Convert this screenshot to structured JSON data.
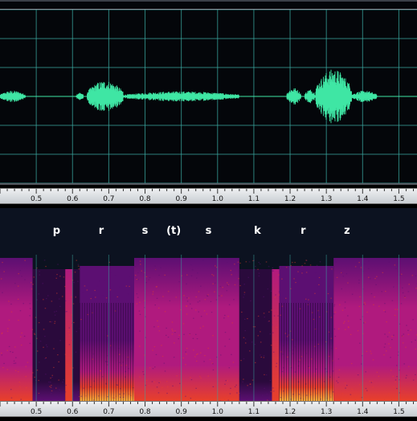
{
  "time_axis": {
    "unit": "s",
    "start": 0.4,
    "end": 1.55,
    "tick_labels": [
      "0.5",
      "0.6",
      "0.7",
      "0.8",
      "0.9",
      "1.0",
      "1.1",
      "1.2",
      "1.3",
      "1.4",
      "1.5"
    ]
  },
  "segments": [
    {
      "label": "p",
      "t": 0.556
    },
    {
      "label": "r",
      "t": 0.679
    },
    {
      "label": "s",
      "t": 0.8
    },
    {
      "label": "(t)",
      "t": 0.879
    },
    {
      "label": "s",
      "t": 0.975
    },
    {
      "label": "k",
      "t": 1.11
    },
    {
      "label": "r",
      "t": 1.236
    },
    {
      "label": "z",
      "t": 1.357
    }
  ],
  "waveform": {
    "color": "#3fe6a4",
    "bursts": [
      {
        "start": 0.4,
        "end": 0.47,
        "amplitude": 0.08
      },
      {
        "start": 0.61,
        "end": 0.63,
        "amplitude": 0.06
      },
      {
        "start": 0.64,
        "end": 0.74,
        "amplitude": 0.22
      },
      {
        "start": 0.74,
        "end": 1.06,
        "amplitude": 0.07
      },
      {
        "start": 1.19,
        "end": 1.23,
        "amplitude": 0.12
      },
      {
        "start": 1.24,
        "end": 1.27,
        "amplitude": 0.1
      },
      {
        "start": 1.27,
        "end": 1.37,
        "amplitude": 0.38
      },
      {
        "start": 1.37,
        "end": 1.44,
        "amplitude": 0.08
      }
    ]
  },
  "spectrogram": {
    "colors": {
      "background": "#0c1220",
      "silence": "#2a0a3c",
      "low": "#5c0f72",
      "mid": "#b01a7e",
      "high": "#e8402a",
      "peak": "#ffb23a"
    },
    "regions": [
      {
        "kind": "fricative",
        "start": 0.4,
        "end": 0.49
      },
      {
        "kind": "silence",
        "start": 0.49,
        "end": 0.58
      },
      {
        "kind": "burst",
        "start": 0.58,
        "end": 0.6
      },
      {
        "kind": "silence",
        "start": 0.6,
        "end": 0.62
      },
      {
        "kind": "voiced",
        "start": 0.62,
        "end": 0.77
      },
      {
        "kind": "fricative",
        "start": 0.77,
        "end": 1.06
      },
      {
        "kind": "silence",
        "start": 1.06,
        "end": 1.15
      },
      {
        "kind": "burst",
        "start": 1.15,
        "end": 1.17
      },
      {
        "kind": "voiced",
        "start": 1.17,
        "end": 1.32
      },
      {
        "kind": "fricative",
        "start": 1.32,
        "end": 1.55
      }
    ]
  },
  "grid_color": "#3aa8a0"
}
